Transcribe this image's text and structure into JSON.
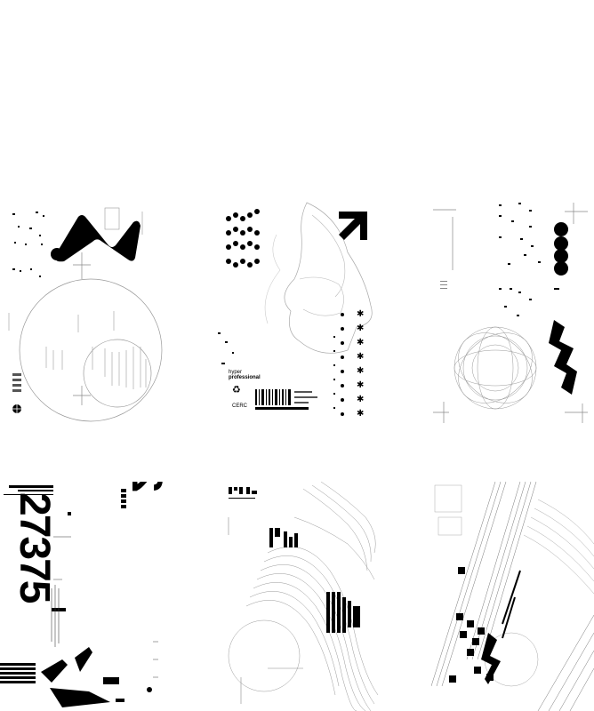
{
  "gallery": {
    "posters": [
      {
        "id": "poster-1"
      },
      {
        "id": "poster-2",
        "label_line1": "hyper",
        "label_line2": "professional",
        "small_code": "CERC"
      },
      {
        "id": "poster-3"
      },
      {
        "id": "poster-4",
        "number": "27375"
      },
      {
        "id": "poster-5"
      },
      {
        "id": "poster-6"
      }
    ]
  },
  "icons": [
    "recycle-icon",
    "arrow-up-right-icon",
    "crosshair-icon",
    "barcode-icon",
    "asterisk-icon"
  ]
}
